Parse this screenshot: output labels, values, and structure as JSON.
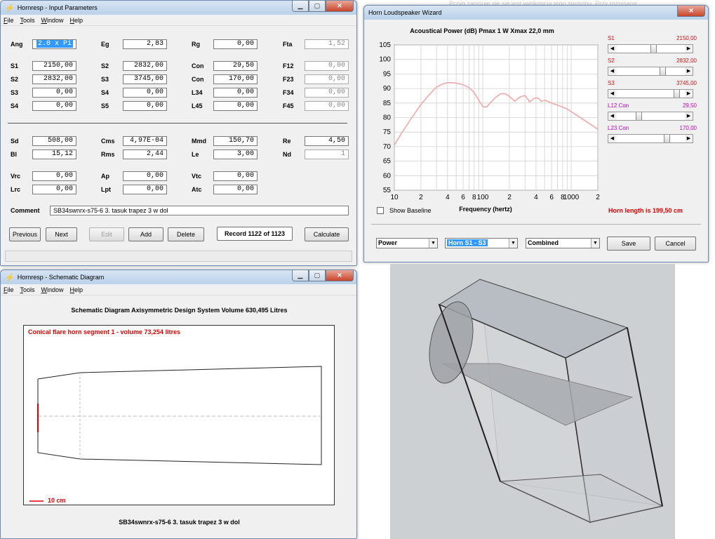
{
  "background_text": "Przyg zapisuje się się jest wielkoscią tego sposobu. Przy rozpisana",
  "input_window": {
    "title": "Hornresp - Input Parameters",
    "menu": [
      "File",
      "Tools",
      "Window",
      "Help"
    ],
    "fields": [
      {
        "label": "Ang",
        "value": "2.0 x Pi",
        "selected": true
      },
      {
        "label": "Eg",
        "value": "2,83"
      },
      {
        "label": "Rg",
        "value": "0,00"
      },
      {
        "label": "Fta",
        "value": "1,52",
        "dim": true
      },
      {
        "label": "S1",
        "value": "2150,00"
      },
      {
        "label": "S2",
        "value": "2832,00"
      },
      {
        "label": "Con",
        "value": "29,50"
      },
      {
        "label": "F12",
        "value": "0,00",
        "dim": true
      },
      {
        "label": "S2",
        "value": "2832,00"
      },
      {
        "label": "S3",
        "value": "3745,00"
      },
      {
        "label": "Con",
        "value": "170,00"
      },
      {
        "label": "F23",
        "value": "0,00",
        "dim": true
      },
      {
        "label": "S3",
        "value": "0,00"
      },
      {
        "label": "S4",
        "value": "0,00"
      },
      {
        "label": "L34",
        "value": "0,00"
      },
      {
        "label": "F34",
        "value": "0,00",
        "dim": true
      },
      {
        "label": "S4",
        "value": "0,00"
      },
      {
        "label": "S5",
        "value": "0,00"
      },
      {
        "label": "L45",
        "value": "0,00"
      },
      {
        "label": "F45",
        "value": "0,00",
        "dim": true
      },
      {
        "label": "Sd",
        "value": "508,00"
      },
      {
        "label": "Cms",
        "value": "4,97E-04"
      },
      {
        "label": "Mmd",
        "value": "150,70"
      },
      {
        "label": "Re",
        "value": "4,50"
      },
      {
        "label": "Bl",
        "value": "15,12"
      },
      {
        "label": "Rms",
        "value": "2,44"
      },
      {
        "label": "Le",
        "value": "3,00"
      },
      {
        "label": "Nd",
        "value": "1",
        "dim": true
      },
      {
        "label": "Vrc",
        "value": "0,00"
      },
      {
        "label": "Ap",
        "value": "0,00"
      },
      {
        "label": "Vtc",
        "value": "0,00"
      },
      {
        "label": "Lrc",
        "value": "0,00"
      },
      {
        "label": "Lpt",
        "value": "0,00"
      },
      {
        "label": "Atc",
        "value": "0,00"
      }
    ],
    "comment_label": "Comment",
    "comment_value": "SB34swnrx-s75-6 3.  tasuk trapez 3 w dol",
    "buttons": {
      "previous": "Previous",
      "next": "Next",
      "edit": "Edit",
      "add": "Add",
      "delete": "Delete",
      "calculate": "Calculate"
    },
    "record": "Record 1122 of 1123"
  },
  "wizard_window": {
    "title": "Horn Loudspeaker Wizard",
    "sliders": [
      {
        "name": "S1",
        "value": "2150,00",
        "color": "#d01010",
        "pos": 0.55
      },
      {
        "name": "S2",
        "value": "2832,00",
        "color": "#d01010",
        "pos": 0.7
      },
      {
        "name": "S3",
        "value": "3745,00",
        "color": "#d01010",
        "pos": 0.92
      },
      {
        "name": "L12  Con",
        "value": "29,50",
        "color": "#c000c0",
        "pos": 0.32
      },
      {
        "name": "L23  Con",
        "value": "170,00",
        "color": "#c000c0",
        "pos": 0.76
      }
    ],
    "show_baseline": "Show Baseline",
    "horn_length": "Horn length is 199,50 cm",
    "combos": {
      "c1": "Power",
      "c2": "Horn S1 - S3",
      "c3": "Combined"
    },
    "save": "Save",
    "cancel": "Cancel"
  },
  "chart_data": {
    "type": "line",
    "title": "Acoustical Power (dB)   Pmax 1 W   Xmax 22,0 mm",
    "xlabel": "Frequency (hertz)",
    "ylabel": "",
    "xscale": "log",
    "xlim": [
      10,
      2000
    ],
    "ylim": [
      55,
      105
    ],
    "yticks": [
      55,
      60,
      65,
      70,
      75,
      80,
      85,
      90,
      95,
      100,
      105
    ],
    "xtick_labels": [
      {
        "v": 10,
        "t": "10"
      },
      {
        "v": 20,
        "t": "2"
      },
      {
        "v": 40,
        "t": "4"
      },
      {
        "v": 60,
        "t": "6"
      },
      {
        "v": 80,
        "t": "8"
      },
      {
        "v": 100,
        "t": "100"
      },
      {
        "v": 200,
        "t": "2"
      },
      {
        "v": 400,
        "t": "4"
      },
      {
        "v": 600,
        "t": "6"
      },
      {
        "v": 800,
        "t": "8"
      },
      {
        "v": 1000,
        "t": "1000"
      },
      {
        "v": 2000,
        "t": "2"
      }
    ],
    "series_color": "#f0a8a8",
    "x": [
      10,
      12,
      15,
      20,
      25,
      30,
      35,
      40,
      45,
      50,
      60,
      70,
      80,
      90,
      100,
      110,
      120,
      140,
      160,
      180,
      200,
      230,
      260,
      300,
      340,
      380,
      420,
      460,
      500,
      560,
      620,
      700,
      800,
      900,
      1000,
      1200,
      1500,
      2000
    ],
    "y": [
      70.5,
      74.5,
      79,
      84.5,
      88,
      90.5,
      91.5,
      92,
      92,
      91.8,
      91.3,
      90.3,
      88.6,
      86,
      83.8,
      83.6,
      84.8,
      87,
      88.2,
      88.2,
      87.3,
      85.6,
      87,
      87.6,
      85.4,
      86.6,
      86.8,
      85.5,
      86,
      85.4,
      84.8,
      84.3,
      83.6,
      83,
      82,
      80.5,
      78.5,
      76
    ]
  },
  "schematic_window": {
    "title": "Hornresp - Schematic Diagram",
    "menu": [
      "File",
      "Tools",
      "Window",
      "Help"
    ],
    "heading": "Schematic Diagram   Axisymmetric Design   System Volume 630,495 Litres",
    "segment_label": "Conical flare horn segment 1 - volume 73,254 litres",
    "scale_label": "10 cm",
    "footer": "SB34swnrx-s75-6 3.  tasuk trapez 3 w dol"
  }
}
